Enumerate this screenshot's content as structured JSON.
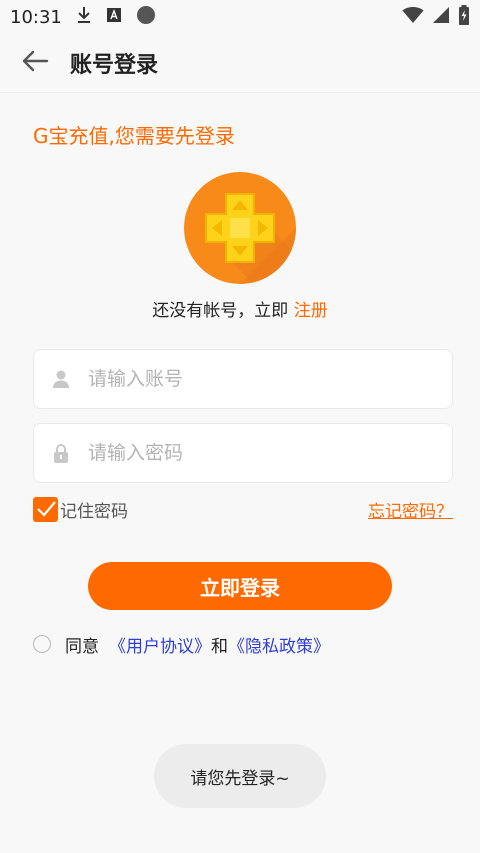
{
  "status_bar": {
    "time": "10:31"
  },
  "header": {
    "title": "账号登录"
  },
  "login": {
    "hint": "G宝充值,您需要先登录",
    "register_prefix": "还没有帐号，立即 ",
    "register_link": "注册",
    "account_placeholder": "请输入账号",
    "password_placeholder": "请输入密码",
    "remember_label": "记住密码",
    "forgot_link": "忘记密码？",
    "login_button": "立即登录",
    "agree_prefix": "同意",
    "user_agreement": "《用户协议》",
    "and": "和",
    "privacy_policy": "《隐私政策》"
  },
  "toast": {
    "message": "请您先登录~"
  },
  "colors": {
    "accent": "#ff6a00",
    "link_blue": "#2f3fd6",
    "background": "#f8f8f8"
  },
  "icons": {
    "back": "arrow-left-icon",
    "download": "download-icon",
    "notification": "font-a-icon",
    "circle": "record-icon",
    "wifi": "wifi-icon",
    "signal": "signal-icon",
    "battery": "battery-charging-icon",
    "user": "user-icon",
    "lock": "lock-icon"
  }
}
